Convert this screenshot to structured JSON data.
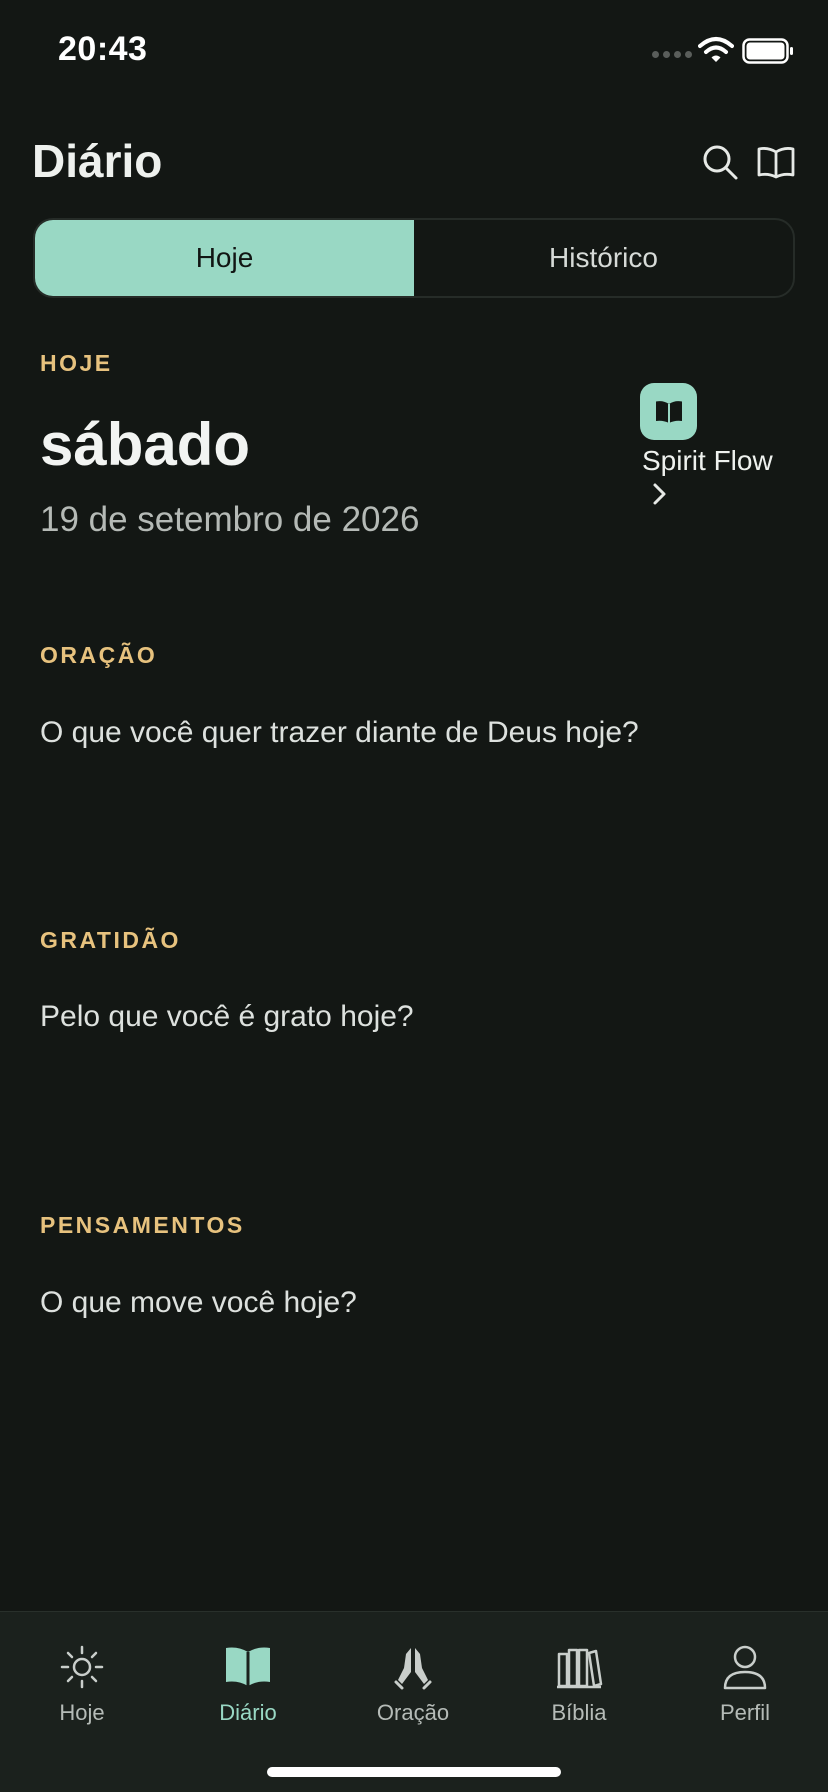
{
  "status_bar": {
    "time": "20:43"
  },
  "header": {
    "title": "Diário"
  },
  "segmented": {
    "today": "Hoje",
    "history": "Histórico"
  },
  "today_section": {
    "label": "HOJE",
    "weekday": "sábado",
    "date": "19 de setembro de 2026"
  },
  "spirit_flow": {
    "label": "Spirit Flow"
  },
  "prayer": {
    "label": "ORAÇÃO",
    "prompt": "O que você quer trazer diante de Deus hoje?"
  },
  "gratitude": {
    "label": "GRATIDÃO",
    "prompt": "Pelo que você é grato hoje?"
  },
  "thoughts": {
    "label": "PENSAMENTOS",
    "prompt": "O que move você hoje?"
  },
  "tab_bar": {
    "items": [
      {
        "label": "Hoje",
        "icon": "sun-icon"
      },
      {
        "label": "Diário",
        "icon": "open-book-icon"
      },
      {
        "label": "Oração",
        "icon": "praying-hands-icon"
      },
      {
        "label": "Bíblia",
        "icon": "bookshelf-icon"
      },
      {
        "label": "Perfil",
        "icon": "person-icon"
      }
    ],
    "active_index": 1
  },
  "colors": {
    "background": "#131714",
    "accent": "#99d8c4",
    "section_label": "#e7c27e",
    "tab_bar": "#1b211d"
  }
}
